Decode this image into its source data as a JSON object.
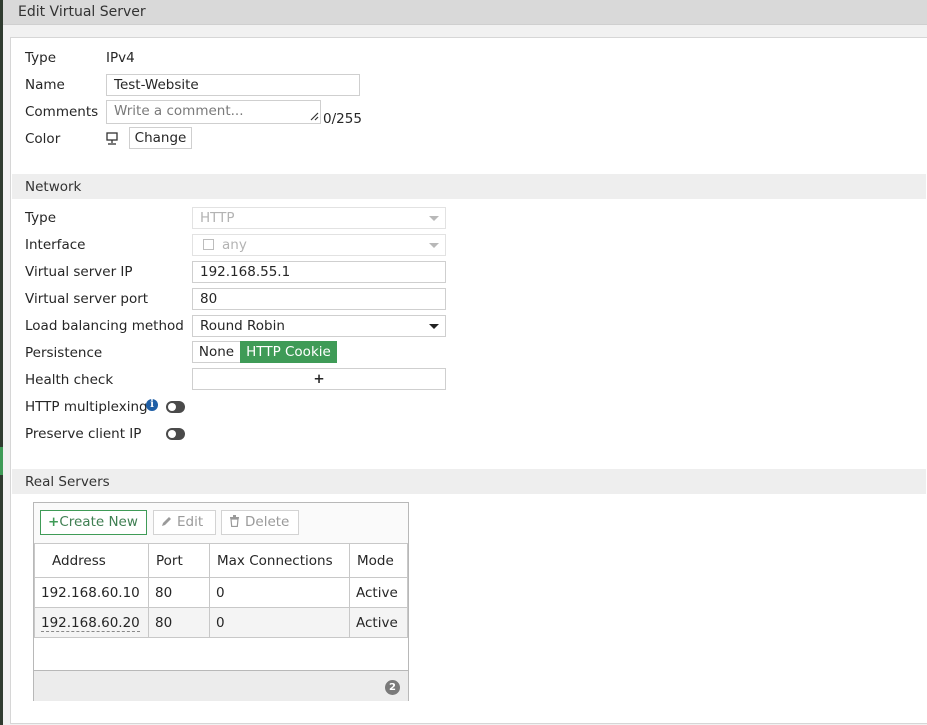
{
  "window": {
    "title": "Edit Virtual Server"
  },
  "general": {
    "type_label": "Type",
    "type_value": "IPv4",
    "name_label": "Name",
    "name_value": "Test-Website",
    "comments_label": "Comments",
    "comments_placeholder": "Write a comment...",
    "comments_counter": "0/255",
    "color_label": "Color",
    "color_icon": "monitor-icon",
    "color_button": "Change"
  },
  "network": {
    "section_title": "Network",
    "type_label": "Type",
    "type_value": "HTTP",
    "interface_label": "Interface",
    "interface_value": "any",
    "vip_label": "Virtual server IP",
    "vip_value": "192.168.55.1",
    "vport_label": "Virtual server port",
    "vport_value": "80",
    "lb_label": "Load balancing method",
    "lb_value": "Round Robin",
    "persistence_label": "Persistence",
    "persistence_options": [
      "None",
      "HTTP Cookie"
    ],
    "persistence_selected": "HTTP Cookie",
    "health_label": "Health check",
    "health_add": "+",
    "multiplex_label": "HTTP multiplexing",
    "multiplex_enabled": false,
    "preserve_label": "Preserve client IP",
    "preserve_enabled": false
  },
  "real_servers": {
    "section_title": "Real Servers",
    "toolbar": {
      "create": "Create New",
      "edit": "Edit",
      "delete": "Delete"
    },
    "columns": [
      "Address",
      "Port",
      "Max Connections",
      "Mode"
    ],
    "rows": [
      [
        "192.168.60.10",
        "80",
        "0",
        "Active"
      ],
      [
        "192.168.60.20",
        "80",
        "0",
        "Active"
      ]
    ],
    "count": "2"
  },
  "colors": {
    "accent_green": "#3f9b57",
    "info_blue": "#1f5fa6"
  }
}
